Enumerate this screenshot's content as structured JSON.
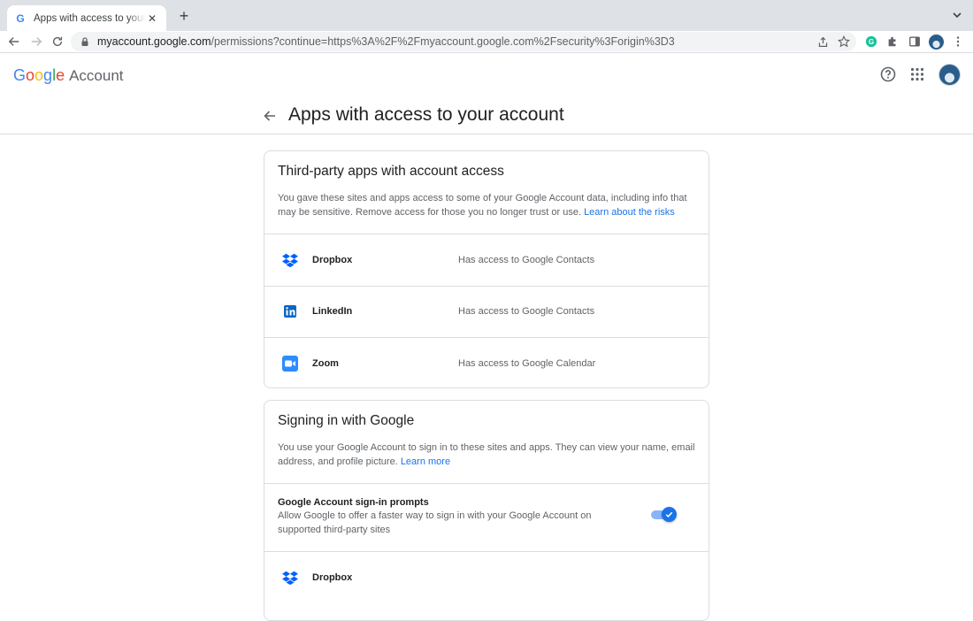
{
  "browser": {
    "tab_title": "Apps with access to your acco",
    "tab_favicon": "G",
    "url_host": "myaccount.google.com",
    "url_path": "/permissions?continue=https%3A%2F%2Fmyaccount.google.com%2Fsecurity%3Forigin%3D3"
  },
  "header": {
    "logo_letters": [
      "G",
      "o",
      "o",
      "g",
      "l",
      "e"
    ],
    "logo_suffix": "Account",
    "icons": [
      "help-icon",
      "apps-grid-icon",
      "avatar"
    ]
  },
  "page": {
    "title": "Apps with access to your account"
  },
  "third_party": {
    "title": "Third-party apps with account access",
    "desc": "You gave these sites and apps access to some of your Google Account data, including info that may be sensitive. Remove access for those you no longer trust or use.",
    "link": "Learn about the risks",
    "apps": [
      {
        "name": "Dropbox",
        "access": "Has access to Google Contacts",
        "icon": "dropbox-icon"
      },
      {
        "name": "LinkedIn",
        "access": "Has access to Google Contacts",
        "icon": "linkedin-icon"
      },
      {
        "name": "Zoom",
        "access": "Has access to Google Calendar",
        "icon": "zoom-icon"
      }
    ]
  },
  "signin": {
    "title": "Signing in with Google",
    "desc": "You use your Google Account to sign in to these sites and apps. They can view your name, email address, and profile picture.",
    "link": "Learn more",
    "prompt_title": "Google Account sign-in prompts",
    "prompt_desc": "Allow Google to offer a faster way to sign in with your Google Account on supported third-party sites",
    "prompt_enabled": true,
    "apps": [
      {
        "name": "Dropbox",
        "icon": "dropbox-icon"
      }
    ]
  },
  "colors": {
    "link": "#1a73e8",
    "toggle": "#1a73e8",
    "dropbox": "#0061ff",
    "linkedin": "#0a66c2",
    "zoom": "#2d8cff"
  }
}
